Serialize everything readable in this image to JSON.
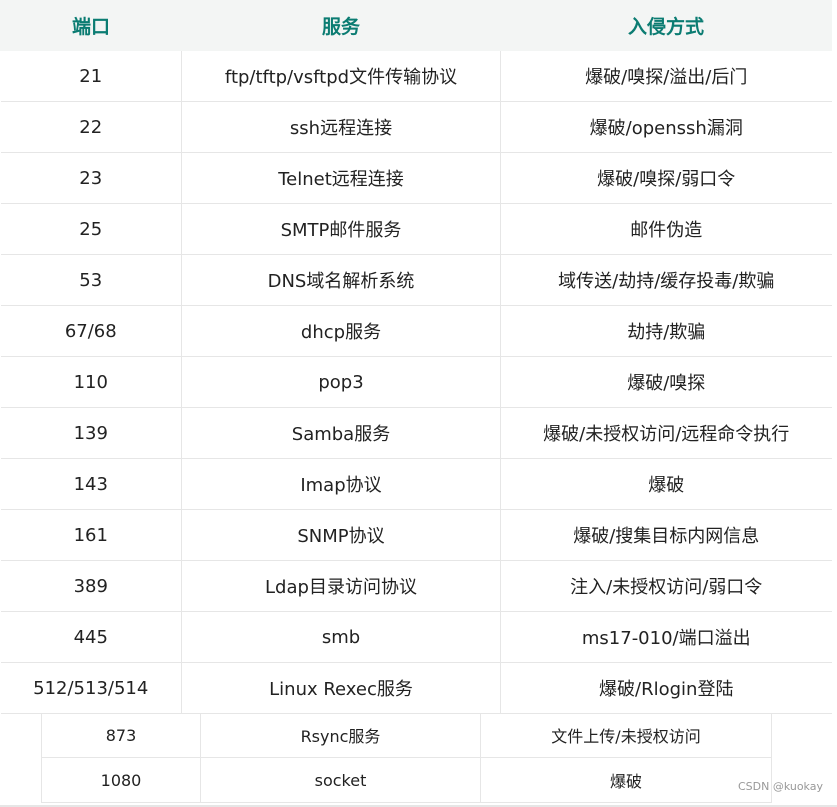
{
  "table": {
    "headers": [
      "端口",
      "服务",
      "入侵方式"
    ],
    "rows": [
      [
        "21",
        "ftp/tftp/vsftpd文件传输协议",
        "爆破/嗅探/溢出/后门"
      ],
      [
        "22",
        "ssh远程连接",
        "爆破/openssh漏洞"
      ],
      [
        "23",
        "Telnet远程连接",
        "爆破/嗅探/弱口令"
      ],
      [
        "25",
        "SMTP邮件服务",
        "邮件伪造"
      ],
      [
        "53",
        "DNS域名解析系统",
        "域传送/劫持/缓存投毒/欺骗"
      ],
      [
        "67/68",
        "dhcp服务",
        "劫持/欺骗"
      ],
      [
        "110",
        "pop3",
        "爆破/嗅探"
      ],
      [
        "139",
        "Samba服务",
        "爆破/未授权访问/远程命令执行"
      ],
      [
        "143",
        "Imap协议",
        "爆破"
      ],
      [
        "161",
        "SNMP协议",
        "爆破/搜集目标内网信息"
      ],
      [
        "389",
        "Ldap目录访问协议",
        "注入/未授权访问/弱口令"
      ],
      [
        "445",
        "smb",
        "ms17-010/端口溢出"
      ],
      [
        "512/513/514",
        "Linux Rexec服务",
        "爆破/Rlogin登陆"
      ]
    ]
  },
  "table2": {
    "rows": [
      [
        "873",
        "Rsync服务",
        "文件上传/未授权访问"
      ],
      [
        "1080",
        "socket",
        "爆破"
      ]
    ]
  },
  "watermark": "CSDN @kuokay"
}
